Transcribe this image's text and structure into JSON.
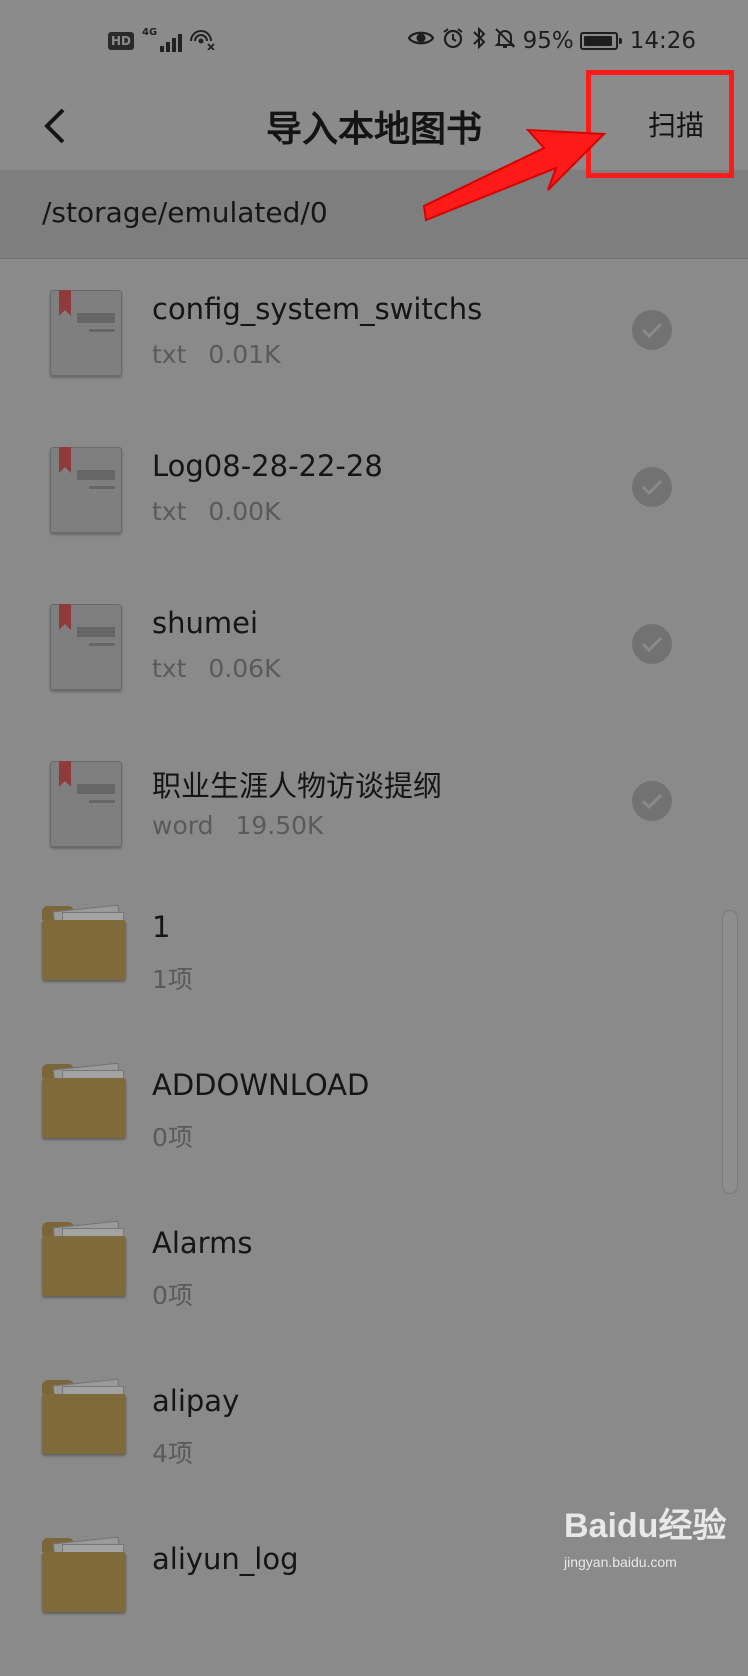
{
  "status_bar": {
    "left_icons": [
      "hd-icon",
      "4g-signal-icon",
      "wifi-hotspot-icon"
    ],
    "hd_label": "HD",
    "network_label": "4G",
    "right_icons": [
      "eye-icon",
      "alarm-icon",
      "bluetooth-icon",
      "mute-icon",
      "battery-icon"
    ],
    "battery_percent": "95%",
    "battery_level": 0.95,
    "time": "14:26"
  },
  "header": {
    "title": "导入本地图书",
    "scan_label": "扫描",
    "back_icon": "chevron-left-icon"
  },
  "path": "/storage/emulated/0",
  "files": [
    {
      "name": "config_system_switchs",
      "type": "txt",
      "size": "0.01K",
      "icon": "document-icon",
      "checked": false
    },
    {
      "name": "Log08-28-22-28",
      "type": "txt",
      "size": "0.00K",
      "icon": "document-icon",
      "checked": false
    },
    {
      "name": "shumei",
      "type": "txt",
      "size": "0.06K",
      "icon": "document-icon",
      "checked": false
    },
    {
      "name": "职业生涯人物访谈提纲",
      "type": "word",
      "size": "19.50K",
      "icon": "document-icon",
      "checked": false
    }
  ],
  "folders": [
    {
      "name": "1",
      "count": "1项",
      "icon": "folder-icon"
    },
    {
      "name": "ADDOWNLOAD",
      "count": "0项",
      "icon": "folder-icon"
    },
    {
      "name": "Alarms",
      "count": "0项",
      "icon": "folder-icon"
    },
    {
      "name": "alipay",
      "count": "4项",
      "icon": "folder-icon"
    },
    {
      "name": "aliyun_log",
      "count": "",
      "icon": "folder-icon"
    }
  ],
  "annotation": {
    "color": "#ff1a1a",
    "target": "scan-button"
  },
  "watermark": {
    "logo_text": "Baidu经验",
    "url": "jingyan.baidu.com"
  },
  "colors": {
    "overlay_gray": "#8a8a8a",
    "folder_brown": "#7f6a3b",
    "bookmark_red": "#8f3b3b"
  }
}
